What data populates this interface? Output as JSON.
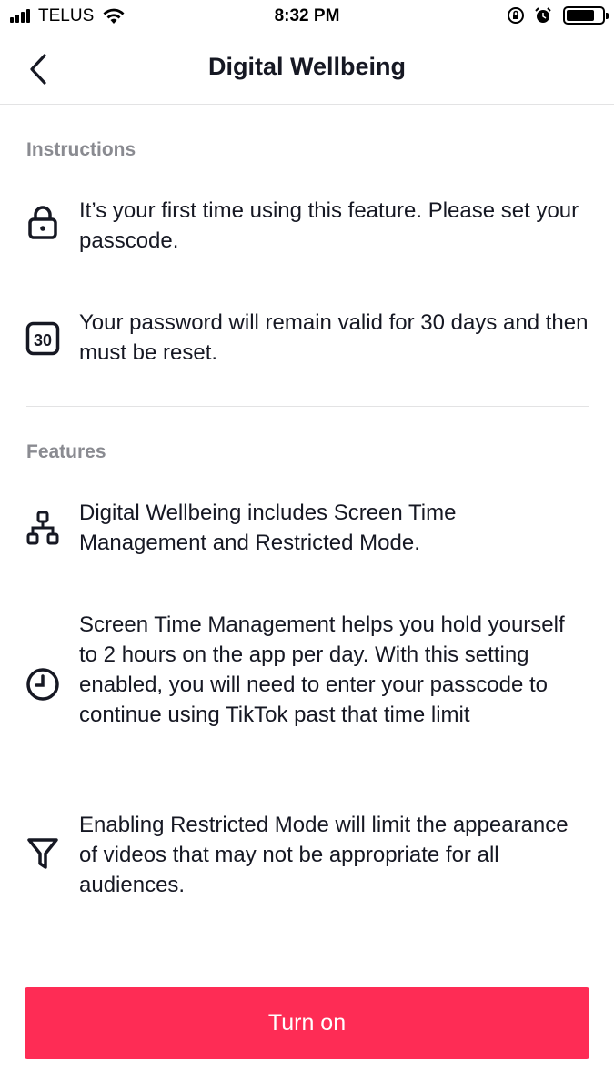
{
  "status_bar": {
    "carrier": "TELUS",
    "time": "8:32 PM"
  },
  "header": {
    "title": "Digital Wellbeing",
    "back_icon": "chevron-left-icon"
  },
  "sections": {
    "instructions": {
      "title": "Instructions",
      "items": [
        {
          "icon": "lock-icon",
          "text": "It’s your first time using this feature. Please set your passcode."
        },
        {
          "icon": "calendar-30-icon",
          "icon_label": "30",
          "text": "Your password will remain valid for 30 days and then must be reset."
        }
      ]
    },
    "features": {
      "title": "Features",
      "items": [
        {
          "icon": "hierarchy-icon",
          "text": "Digital Wellbeing includes Screen Time Management and Restricted Mode."
        },
        {
          "icon": "clock-icon",
          "text": "Screen Time Management helps you hold yourself to 2 hours on the app per day. With this setting enabled, you will need to enter your passcode to continue using TikTok past that time limit"
        },
        {
          "icon": "filter-icon",
          "text": "Enabling Restricted Mode will limit the appearance of videos that may not be appropriate for all audiences."
        }
      ]
    }
  },
  "primary_button": {
    "label": "Turn on",
    "color": "#fe2c55"
  },
  "colors": {
    "accent": "#fe2c55",
    "text": "#161823",
    "section_title": "#8a8b91"
  }
}
